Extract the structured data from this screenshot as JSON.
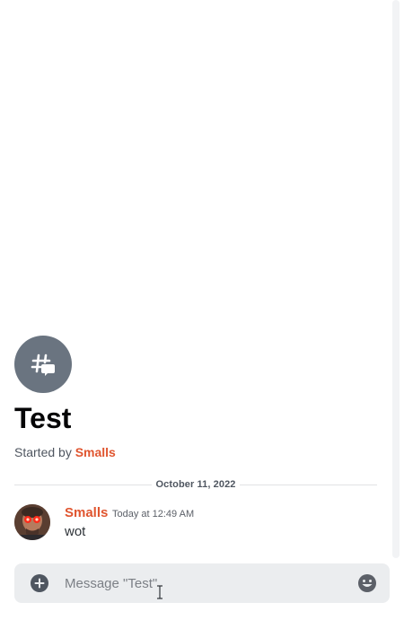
{
  "thread": {
    "title": "Test",
    "started_by_prefix": "Started by ",
    "author": "Smalls"
  },
  "divider": {
    "date": "October 11, 2022"
  },
  "messages": [
    {
      "author": "Smalls",
      "timestamp": "Today at 12:49 AM",
      "text": "wot"
    }
  ],
  "composer": {
    "placeholder": "Message \"Test\""
  },
  "colors": {
    "accent": "#e0552f",
    "thread_icon_bg": "#6a7480",
    "composer_bg": "#ebedef"
  },
  "icons": {
    "thread": "thread-icon",
    "add": "plus-circle-icon",
    "emoji": "emoji-icon"
  }
}
